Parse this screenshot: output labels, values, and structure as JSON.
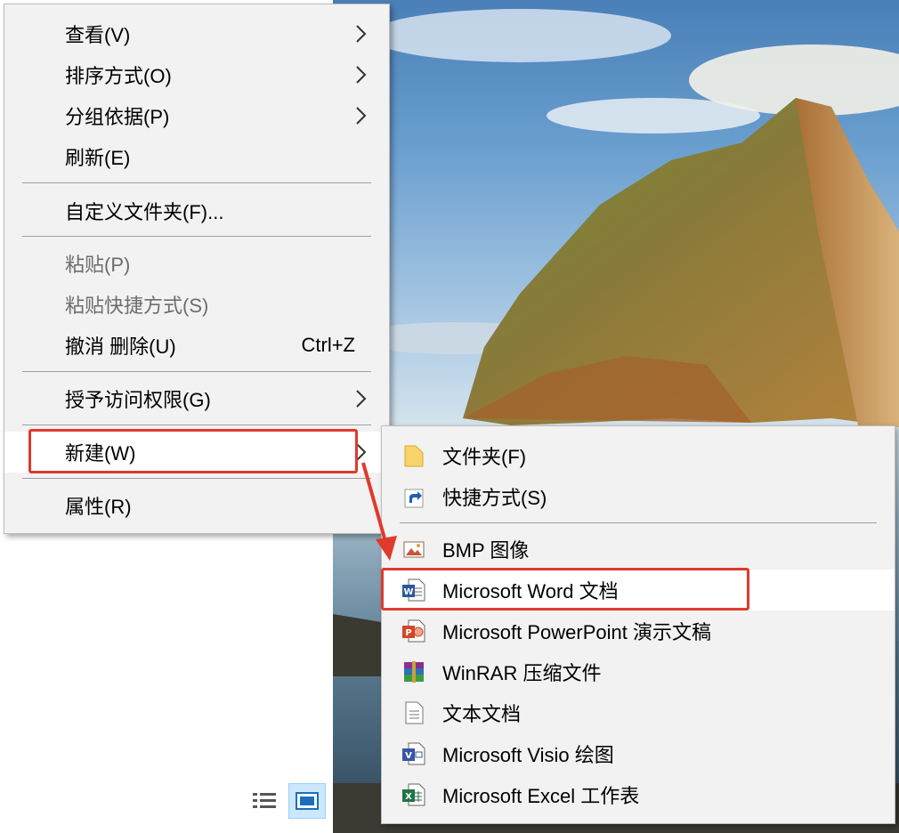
{
  "main_menu": {
    "items": [
      {
        "label": "查看(V)",
        "has_submenu": true
      },
      {
        "label": "排序方式(O)",
        "has_submenu": true
      },
      {
        "label": "分组依据(P)",
        "has_submenu": true
      },
      {
        "label": "刷新(E)"
      },
      {
        "label": "自定义文件夹(F)..."
      },
      {
        "label": "粘贴(P)",
        "disabled": true
      },
      {
        "label": "粘贴快捷方式(S)",
        "disabled": true
      },
      {
        "label": "撤消 删除(U)",
        "accelerator": "Ctrl+Z"
      },
      {
        "label": "授予访问权限(G)",
        "has_submenu": true
      },
      {
        "label": "新建(W)",
        "has_submenu": true,
        "highlighted": true
      },
      {
        "label": "属性(R)"
      }
    ]
  },
  "new_submenu": {
    "items": [
      {
        "label": "文件夹(F)",
        "icon": "folder-icon"
      },
      {
        "label": "快捷方式(S)",
        "icon": "shortcut-icon"
      },
      {
        "label": "BMP 图像",
        "icon": "bmp-image-icon"
      },
      {
        "label": "Microsoft Word 文档",
        "icon": "word-document-icon",
        "highlighted": true
      },
      {
        "label": "Microsoft PowerPoint 演示文稿",
        "icon": "powerpoint-icon"
      },
      {
        "label": "WinRAR 压缩文件",
        "icon": "winrar-icon"
      },
      {
        "label": "文本文档",
        "icon": "text-document-icon"
      },
      {
        "label": "Microsoft Visio 绘图",
        "icon": "visio-icon"
      },
      {
        "label": "Microsoft Excel 工作表",
        "icon": "excel-icon"
      }
    ]
  },
  "colors": {
    "annotation_red": "#e03a2c",
    "menu_bg": "#f2f2f2",
    "word_blue": "#2b579a",
    "powerpoint_orange": "#d24726",
    "excel_green": "#217346",
    "visio_blue": "#3955a3"
  },
  "view_toggle": {
    "icons": [
      "details-view-icon",
      "large-icons-view-icon"
    ],
    "active": "large-icons-view-icon"
  }
}
